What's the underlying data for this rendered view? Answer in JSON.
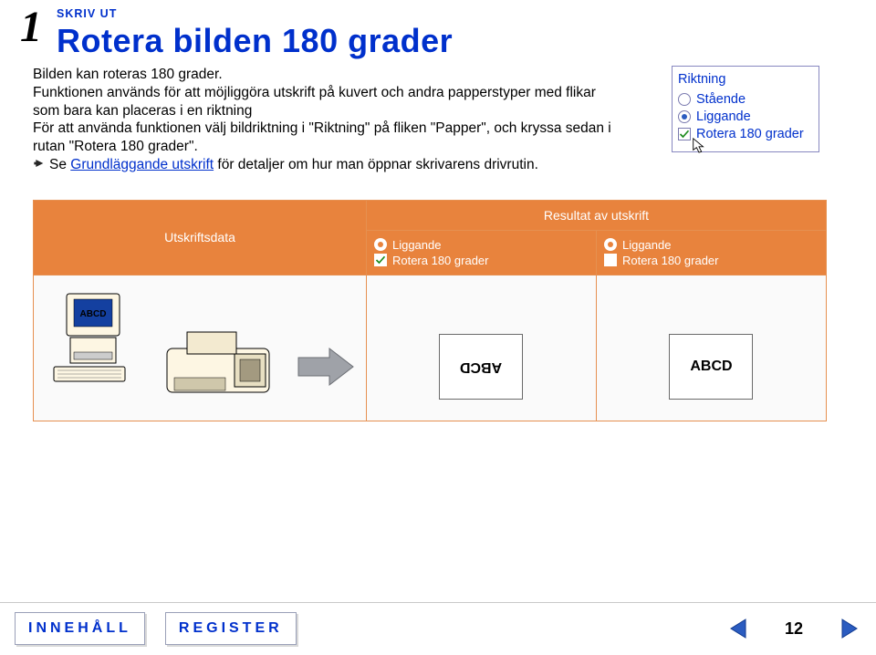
{
  "header": {
    "section_number": "1",
    "breadcrumb": "SKRIV UT",
    "title": "Rotera bilden 180 grader"
  },
  "paragraph": {
    "line1": "Bilden kan roteras 180 grader.",
    "line2": "Funktionen används för att möjliggöra utskrift på kuvert och andra papperstyper med flikar som bara kan placeras i en riktning",
    "line3": "För att använda funktionen välj bildriktning i \"Riktning\" på fliken \"Papper\", och kryssa sedan i rutan \"Rotera 180 grader\".",
    "see_prefix": "Se ",
    "see_link": "Grundläggande utskrift",
    "see_suffix": " för detaljer om hur man öppnar skrivarens drivrutin."
  },
  "panel": {
    "caption": "Riktning",
    "option_portrait": "Stående",
    "option_landscape": "Liggande",
    "checkbox_label": "Rotera 180 grader"
  },
  "table": {
    "col_data_header": "Utskriftsdata",
    "col_result_header": "Resultat av utskrift",
    "sub_landscape": "Liggande",
    "sub_rotate": "Rotera 180 grader",
    "sample_text": "ABCD"
  },
  "footer": {
    "nav_contents": "INNEHÅLL",
    "nav_index": "REGISTER",
    "page": "12"
  },
  "icons": {
    "hand": "pointing-hand-icon",
    "cursor": "mouse-pointer-icon",
    "prev": "triangle-left-icon",
    "next": "triangle-right-icon"
  },
  "colors": {
    "brand_blue": "#0030cc",
    "brand_orange": "#e8833d"
  }
}
